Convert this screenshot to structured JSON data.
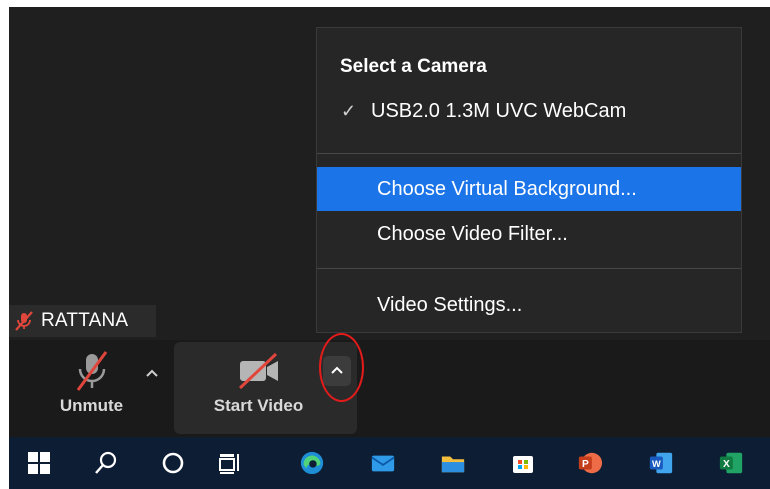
{
  "participant": {
    "name": "RATTANA"
  },
  "controls": {
    "unmute_label": "Unmute",
    "start_video_label": "Start Video",
    "audio_options_icon": "chevron-up-icon",
    "video_options_icon": "chevron-up-icon"
  },
  "camera_menu": {
    "heading": "Select a Camera",
    "camera_check": "✓",
    "camera_option": "USB2.0 1.3M UVC WebCam",
    "items": [
      {
        "label": "Choose Virtual Background...",
        "selected": true
      },
      {
        "label": "Choose Video Filter..."
      },
      {
        "label": "Video Settings..."
      }
    ]
  },
  "taskbar": {
    "icons": [
      "windows-start-icon",
      "search-icon",
      "cortana-icon",
      "task-view-icon",
      "edge-icon",
      "mail-icon",
      "file-explorer-icon",
      "microsoft-store-icon",
      "powerpoint-icon",
      "word-icon",
      "excel-icon"
    ]
  },
  "colors": {
    "menu_highlight": "#1b74e8",
    "annotation_circle": "#e21b1b",
    "muted_red": "#e0463c",
    "taskbar_bg": "#0c1d34"
  }
}
